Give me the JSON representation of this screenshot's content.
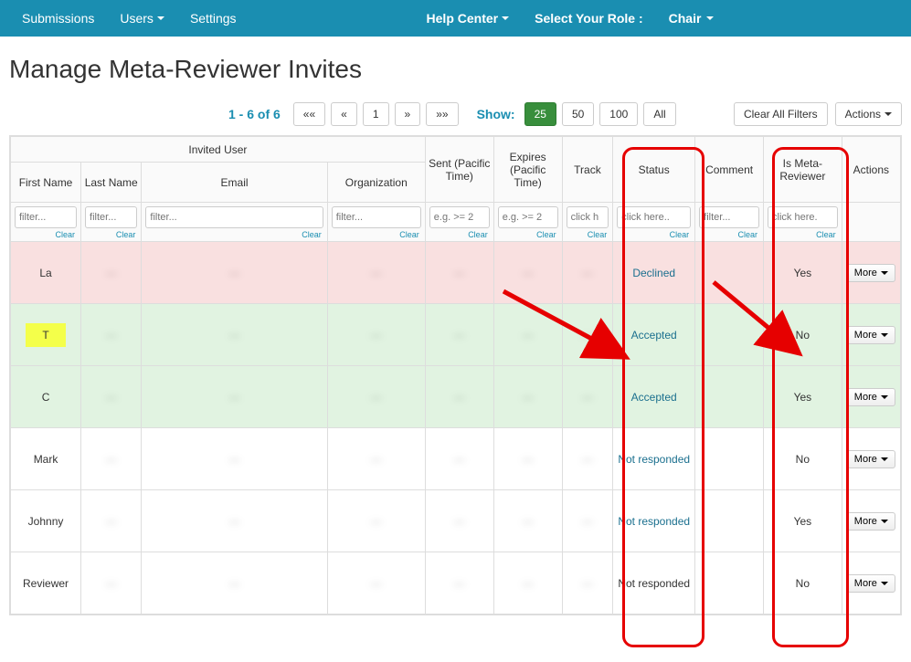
{
  "nav": {
    "submissions": "Submissions",
    "users": "Users",
    "settings": "Settings",
    "help": "Help Center",
    "select_role": "Select Your Role :",
    "role": "Chair"
  },
  "page_title": "Manage Meta-Reviewer Invites",
  "pager": {
    "label": "1 - 6 of 6",
    "first": "««",
    "prev": "«",
    "page": "1",
    "next": "»",
    "last": "»»"
  },
  "show": {
    "label": "Show:",
    "opt25": "25",
    "opt50": "50",
    "opt100": "100",
    "all": "All"
  },
  "buttons": {
    "clear_filters": "Clear All Filters",
    "actions": "Actions",
    "more": "More"
  },
  "headers": {
    "invited_user": "Invited User",
    "first_name": "First Name",
    "last_name": "Last Name",
    "email": "Email",
    "organization": "Organization",
    "sent": "Sent (Pacific Time)",
    "expires": "Expires (Pacific Time)",
    "track": "Track",
    "status": "Status",
    "comment": "Comment",
    "is_meta": "Is Meta-Reviewer",
    "actions": "Actions"
  },
  "filters": {
    "text_ph": "filter...",
    "date_ph": "e.g. >= 2",
    "click_ph": "click here..",
    "click_ph_short": "click h",
    "click_ph_trunc": "click here.",
    "clear": "Clear"
  },
  "rows": [
    {
      "first": "La",
      "last": "—",
      "email": "—",
      "org": "—",
      "sent": "—",
      "expires": "—",
      "track": "—",
      "status": "Declined",
      "comment": "",
      "is_meta": "Yes",
      "row_class": "row-declined",
      "hl": false,
      "status_link": true
    },
    {
      "first": "T",
      "last": "—",
      "email": "—",
      "org": "—",
      "sent": "—",
      "expires": "—",
      "track": "—",
      "status": "Accepted",
      "comment": "",
      "is_meta": "No",
      "row_class": "row-accepted",
      "hl": true,
      "status_link": true
    },
    {
      "first": "C",
      "last": "—",
      "email": "—",
      "org": "—",
      "sent": "—",
      "expires": "—",
      "track": "—",
      "status": "Accepted",
      "comment": "",
      "is_meta": "Yes",
      "row_class": "row-accepted",
      "hl": false,
      "status_link": true
    },
    {
      "first": "Mark",
      "last": "—",
      "email": "—",
      "org": "—",
      "sent": "—",
      "expires": "—",
      "track": "—",
      "status": "Not responded",
      "comment": "",
      "is_meta": "No",
      "row_class": "row-normal",
      "hl": false,
      "status_link": true
    },
    {
      "first": "Johnny",
      "last": "—",
      "email": "—",
      "org": "—",
      "sent": "—",
      "expires": "—",
      "track": "—",
      "status": "Not responded",
      "comment": "",
      "is_meta": "Yes",
      "row_class": "row-normal",
      "hl": false,
      "status_link": true
    },
    {
      "first": "Reviewer",
      "last": "—",
      "email": "—",
      "org": "—",
      "sent": "—",
      "expires": "—",
      "track": "—",
      "status": "Not responded",
      "comment": "",
      "is_meta": "No",
      "row_class": "row-normal",
      "hl": false,
      "status_link": false
    }
  ]
}
